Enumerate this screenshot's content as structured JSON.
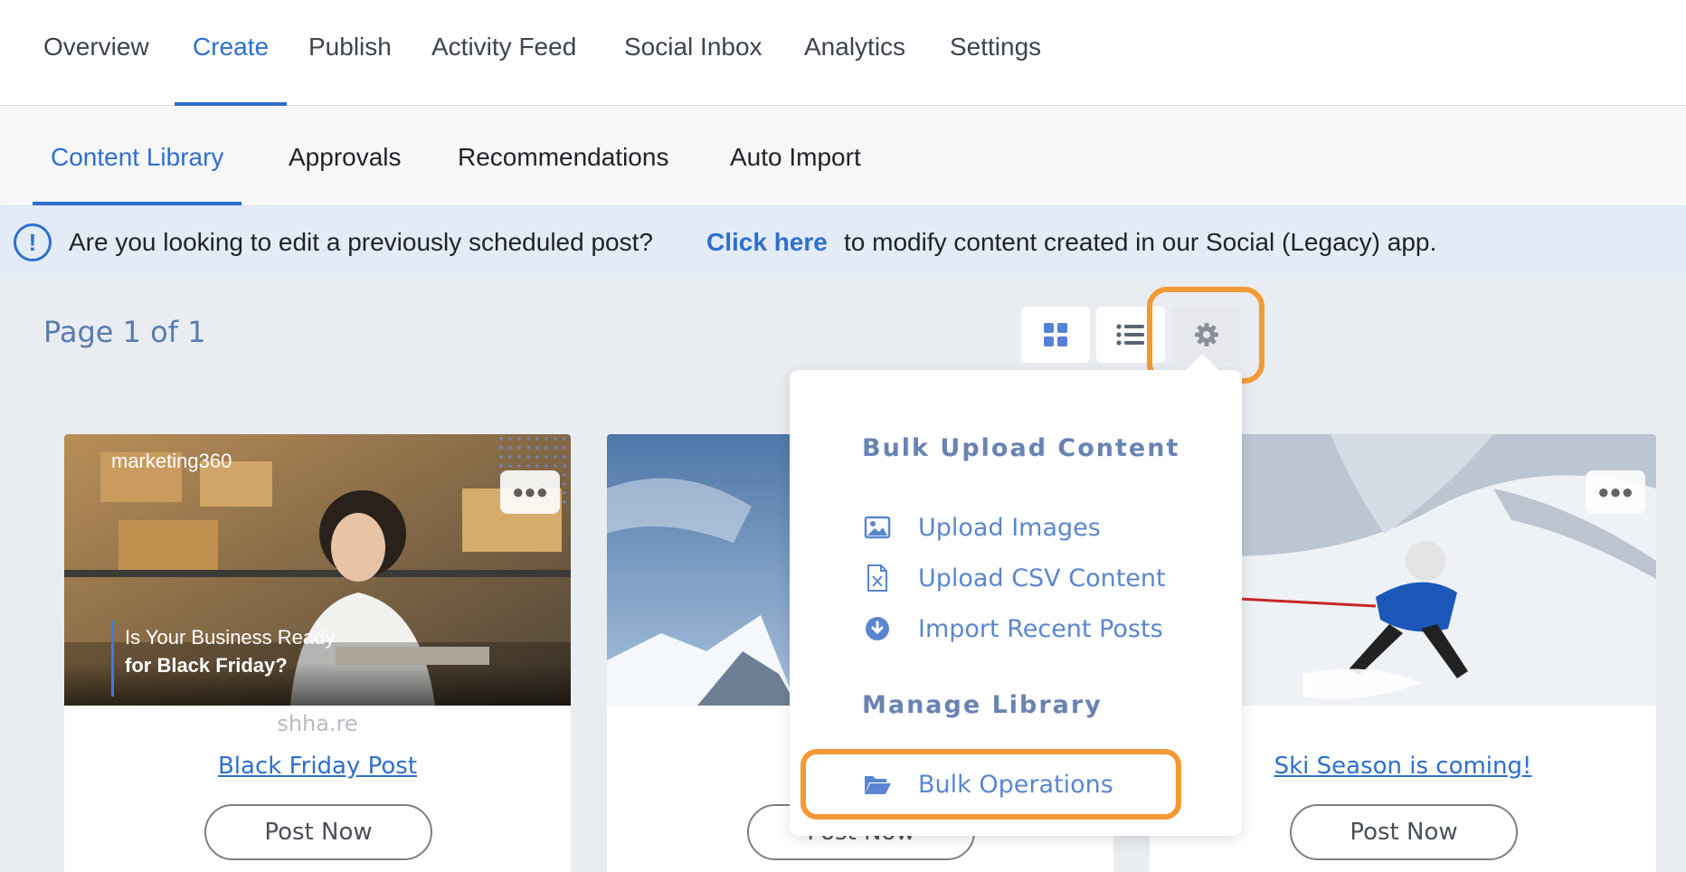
{
  "top_nav": {
    "tabs": [
      {
        "label": "Overview"
      },
      {
        "label": "Create"
      },
      {
        "label": "Publish"
      },
      {
        "label": "Activity Feed"
      },
      {
        "label": "Social Inbox"
      },
      {
        "label": "Analytics"
      },
      {
        "label": "Settings"
      }
    ],
    "active": "Create"
  },
  "sub_nav": {
    "tabs": [
      {
        "label": "Content Library"
      },
      {
        "label": "Approvals"
      },
      {
        "label": "Recommendations"
      },
      {
        "label": "Auto Import"
      }
    ],
    "active": "Content Library"
  },
  "banner": {
    "icon": "info-icon",
    "icon_glyph": "!",
    "message_before": "Are you looking to edit a previously scheduled post?",
    "link_text": "Click here",
    "message_after": "to modify content created in our Social (Legacy) app."
  },
  "pagination": {
    "label": "Page 1 of 1"
  },
  "view_controls": {
    "grid": "grid-view-icon",
    "list": "list-view-icon",
    "settings": "gear-icon"
  },
  "dropdown": {
    "section1_heading": "Bulk Upload Content",
    "upload_images": "Upload Images",
    "upload_csv": "Upload CSV Content",
    "import_recent": "Import Recent Posts",
    "section2_heading": "Manage Library",
    "bulk_operations": "Bulk Operations"
  },
  "cards": [
    {
      "title": "Black Friday Post",
      "button": "Post Now",
      "watermark": "shha.re",
      "logo": "marketing360",
      "headline_line1": "Is Your Business Ready",
      "headline_line2": "for Black Friday?"
    },
    {
      "button": "Post Now"
    },
    {
      "title": "Ski Season is coming!",
      "button": "Post Now"
    }
  ],
  "colors": {
    "accent": "#2d6fcf",
    "highlight": "#f29a36"
  }
}
